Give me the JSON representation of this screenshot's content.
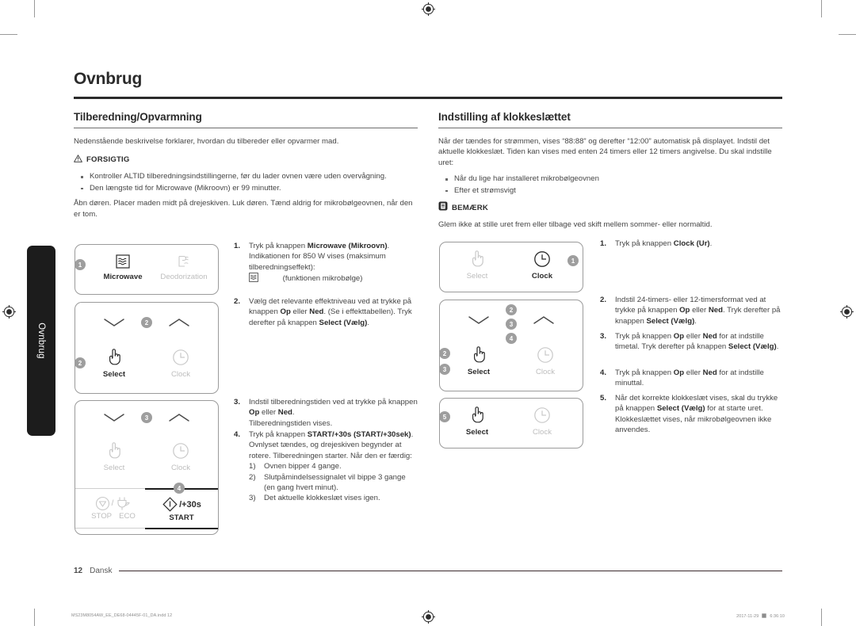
{
  "sidetab": {
    "label": "Ovnbrug"
  },
  "chapter": {
    "title": "Ovnbrug"
  },
  "left": {
    "section_title": "Tilberedning/Opvarmning",
    "intro": "Nedenstående beskrivelse forklarer, hvordan du tilbereder eller opvarmer mad.",
    "caution_label": "FORSIGTIG",
    "caution_items": [
      "Kontroller ALTID tilberedningsindstillingerne, før du lader ovnen være uden overvågning.",
      "Den længste tid for Microwave (Mikroovn) er 99 minutter."
    ],
    "after_caution": "Åbn døren. Placer maden midt på drejeskiven. Luk døren. Tænd aldrig for mikrobølgeovnen, når den er tom.",
    "steps": [
      {
        "num": "1.",
        "text_a": "Tryk på knappen ",
        "bold_a": "Microwave (Mikroovn)",
        "text_b": ". Indikationen for 850 W vises (maksimum tilberedningseffekt):",
        "icon_note": "(funktionen mikrobølge)"
      },
      {
        "num": "2.",
        "text_a": "Vælg det relevante effektniveau ved at trykke på knappen ",
        "bold_a": "Op",
        "text_b": " eller ",
        "bold_b": "Ned",
        "text_c": ". (Se i effekttabellen). Tryk derefter på knappen ",
        "bold_c": "Select (Vælg)",
        "text_d": "."
      },
      {
        "num": "3.",
        "text_a": "Indstil tilberedningstiden ved at trykke på knappen ",
        "bold_a": "Op",
        "text_b": " eller ",
        "bold_b": "Ned",
        "text_c": ".",
        "text_d": "Tilberedningstiden vises."
      },
      {
        "num": "4.",
        "text_a": "Tryk på knappen ",
        "bold_a": "START/+30s (START/+30sek)",
        "text_b": ".",
        "text_c": "Ovnlyset tændes, og drejeskiven begynder at rotere. Tilberedningen starter. Når den er færdig:",
        "substeps": [
          {
            "n": "1)",
            "t": "Ovnen bipper 4 gange."
          },
          {
            "n": "2)",
            "t": "Slutpåmindelsessignalet vil bippe 3 gange (en gang hvert minut)."
          },
          {
            "n": "3)",
            "t": "Det aktuelle klokkeslæt vises igen."
          }
        ]
      }
    ]
  },
  "right": {
    "section_title": "Indstilling af klokkeslættet",
    "intro": "Når der tændes for strømmen, vises “88:88” og derefter “12:00” automatisk på displayet. Indstil det aktuelle klokkeslæt. Tiden kan vises med enten 24 timers eller 12 timers angivelse. Du skal indstille uret:",
    "bullets": [
      "Når du lige har installeret mikrobølgeovnen",
      "Efter et strømsvigt"
    ],
    "note_label": "BEMÆRK",
    "note_text": "Glem ikke at stille uret frem eller tilbage ved skift mellem sommer- eller normaltid.",
    "steps": [
      {
        "num": "1.",
        "text_a": "Tryk på knappen ",
        "bold_a": "Clock (Ur)",
        "text_b": "."
      },
      {
        "num": "2.",
        "text_a": "Indstil 24-timers- eller 12-timersformat ved at trykke på knappen ",
        "bold_a": "Op",
        "text_b": " eller ",
        "bold_b": "Ned",
        "text_c": ". Tryk derefter på knappen ",
        "bold_c": "Select (Vælg)",
        "text_d": "."
      },
      {
        "num": "3.",
        "text_a": "Tryk på knappen ",
        "bold_a": "Op",
        "text_b": " eller ",
        "bold_b": "Ned",
        "text_c": " for at indstille timetal. Tryk derefter på knappen ",
        "bold_c": "Select (Vælg)",
        "text_d": "."
      },
      {
        "num": "4.",
        "text_a": "Tryk på knappen ",
        "bold_a": "Op",
        "text_b": " eller ",
        "bold_b": "Ned",
        "text_c": " for at indstille minuttal."
      },
      {
        "num": "5.",
        "text_a": "Når det korrekte klokkeslæt vises, skal du trykke på knappen ",
        "bold_a": "Select (Vælg)",
        "text_b": " for at starte uret.",
        "text_c": "Klokkeslættet vises, når mikrobølgeovnen ikke anvendes."
      }
    ]
  },
  "panels": {
    "left1": {
      "key1": "Microwave",
      "key2": "Deodorization",
      "badge1": "1"
    },
    "left2": {
      "key1": "Select",
      "key2": "Clock",
      "badge_top": "2",
      "badge_left": "2"
    },
    "left3": {
      "key1": "Select",
      "key2": "Clock",
      "badge_top": "3",
      "badge_start": "4",
      "stop": "STOP",
      "eco": "ECO",
      "start": "START",
      "plus30": "/+30s",
      "slash": "/"
    },
    "right1": {
      "key1": "Select",
      "key2": "Clock",
      "badge1": "1"
    },
    "right2": {
      "key1": "Select",
      "key2": "Clock",
      "badge_c1": "2",
      "badge_c2": "3",
      "badge_c3": "4",
      "badge_l1": "2",
      "badge_l2": "3"
    },
    "right3": {
      "key1": "Select",
      "key2": "Clock",
      "badge5": "5"
    }
  },
  "footer": {
    "page_number": "12",
    "language": "Dansk",
    "print_file": "MS23M8054AW_EE_DE68-04445F-01_DA.indd   12",
    "print_date": "2017-11-29",
    "print_time": "6:36:10"
  }
}
